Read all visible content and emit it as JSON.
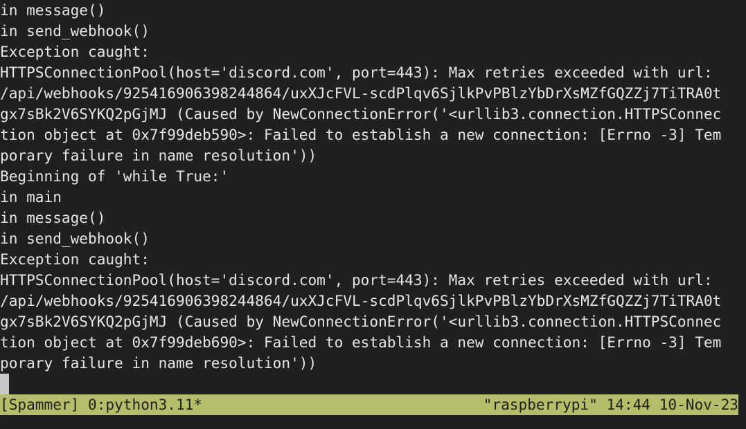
{
  "terminal": {
    "lines": [
      "in message()",
      "in send_webhook()",
      "Exception caught:",
      "HTTPSConnectionPool(host='discord.com', port=443): Max retries exceeded with url:",
      "/api/webhooks/925416906398244864/uxXJcFVL-scdPlqv6SjlkPvPBlzYbDrXsMZfGQZZj7TiTRA0t",
      "gx7sBk2V6SYKQ2pGjMJ (Caused by NewConnectionError('<urllib3.connection.HTTPSConnec",
      "tion object at 0x7f99deb590>: Failed to establish a new connection: [Errno -3] Tem",
      "porary failure in name resolution'))",
      "Beginning of 'while True:'",
      "in main",
      "in message()",
      "in send_webhook()",
      "Exception caught:",
      "HTTPSConnectionPool(host='discord.com', port=443): Max retries exceeded with url:",
      "/api/webhooks/925416906398244864/uxXJcFVL-scdPlqv6SjlkPvPBlzYbDrXsMZfGQZZj7TiTRA0t",
      "gx7sBk2V6SYKQ2pGjMJ (Caused by NewConnectionError('<urllib3.connection.HTTPSConnec",
      "tion object at 0x7f99deb690>: Failed to establish a new connection: [Errno -3] Tem",
      "porary failure in name resolution'))"
    ]
  },
  "statusbar": {
    "left": "[Spammer] 0:python3.11*",
    "right": "\"raspberrypi\" 14:44 10-Nov-23"
  },
  "colors": {
    "background": "#1e2022",
    "foreground": "#e6e6e6",
    "statusbar_bg": "#b5bd68",
    "statusbar_fg": "#1d1f21",
    "cursor": "#c8c8c8"
  }
}
